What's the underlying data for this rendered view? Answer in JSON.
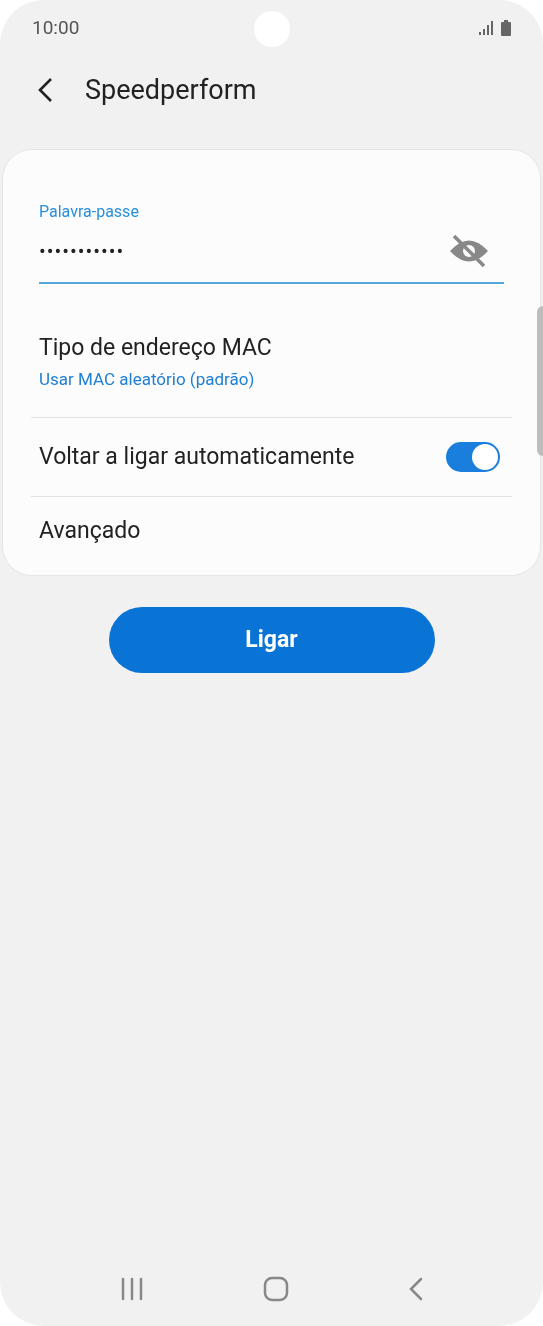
{
  "status_bar": {
    "time": "10:00"
  },
  "header": {
    "title": "Speedperform"
  },
  "password_field": {
    "label": "Palavra-passe",
    "value": "•••••••••••",
    "visible": false
  },
  "settings": [
    {
      "kind": "value",
      "title": "Tipo de endereço MAC",
      "value": "Usar MAC aleatório (padrão)"
    },
    {
      "kind": "toggle",
      "title": "Voltar a ligar automaticamente",
      "on": true
    },
    {
      "kind": "plain",
      "title": "Avançado"
    }
  ],
  "connect_button": {
    "label": "Ligar"
  }
}
